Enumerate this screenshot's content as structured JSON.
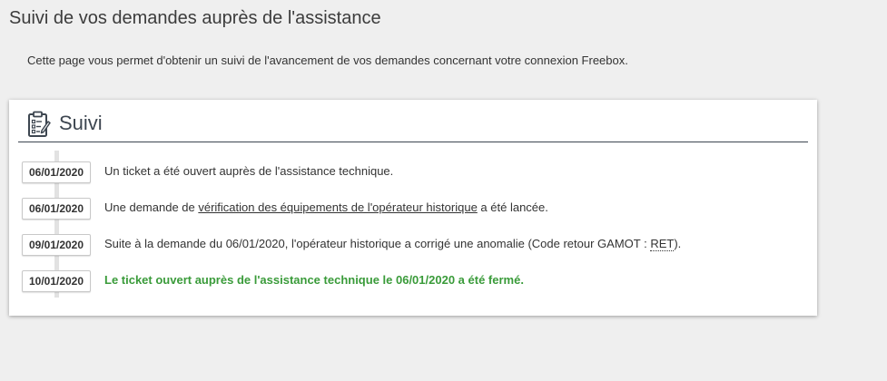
{
  "page": {
    "title": "Suivi de vos demandes auprès de l'assistance",
    "intro": "Cette page vous permet d'obtenir un suivi de l'avancement de vos demandes concernant votre connexion Freebox."
  },
  "panel": {
    "title": "Suivi",
    "icon": "clipboard-icon"
  },
  "events": [
    {
      "date": "06/01/2020",
      "text": "Un ticket a été ouvert auprès de l'assistance technique."
    },
    {
      "date": "06/01/2020",
      "text_before": "Une demande de ",
      "link": "vérification des équipements de l'opérateur historique",
      "text_after": " a été lancée."
    },
    {
      "date": "09/01/2020",
      "text_before": "Suite à la demande du 06/01/2020, l'opérateur historique a corrigé une anomalie (Code retour GAMOT : ",
      "code": "RET",
      "text_after": ")."
    },
    {
      "date": "10/01/2020",
      "text": "Le ticket ouvert auprès de l'assistance technique le 06/01/2020 a été fermé."
    }
  ],
  "colors": {
    "background": "#efefef",
    "panel": "#ffffff",
    "header_rule": "#3d4650",
    "closed_text": "#3a9b3a"
  }
}
